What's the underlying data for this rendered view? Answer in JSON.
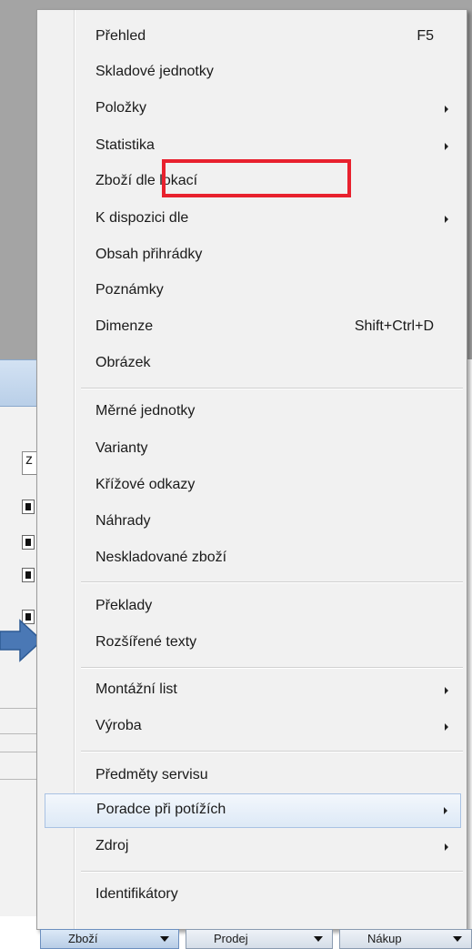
{
  "background": {
    "field_text": "z"
  },
  "menu": {
    "items": [
      {
        "label": "Přehled",
        "shortcut": "F5",
        "submenu": false
      },
      {
        "label": "Skladové jednotky",
        "shortcut": "",
        "submenu": false
      },
      {
        "label": "Položky",
        "shortcut": "",
        "submenu": true
      },
      {
        "label": "Statistika",
        "shortcut": "",
        "submenu": true
      },
      {
        "label": "Zboží dle lokací",
        "shortcut": "",
        "submenu": false,
        "annotated": true
      },
      {
        "label": "K dispozici dle",
        "shortcut": "",
        "submenu": true
      },
      {
        "label": "Obsah přihrádky",
        "shortcut": "",
        "submenu": false
      },
      {
        "label": "Poznámky",
        "shortcut": "",
        "submenu": false
      },
      {
        "label": "Dimenze",
        "shortcut": "Shift+Ctrl+D",
        "submenu": false
      },
      {
        "label": "Obrázek",
        "shortcut": "",
        "submenu": false
      },
      {
        "label": "Měrné jednotky",
        "shortcut": "",
        "submenu": false
      },
      {
        "label": "Varianty",
        "shortcut": "",
        "submenu": false
      },
      {
        "label": "Křížové odkazy",
        "shortcut": "",
        "submenu": false
      },
      {
        "label": "Náhrady",
        "shortcut": "",
        "submenu": false
      },
      {
        "label": "Neskladované zboží",
        "shortcut": "",
        "submenu": false
      },
      {
        "label": "Překlady",
        "shortcut": "",
        "submenu": false
      },
      {
        "label": "Rozšířené texty",
        "shortcut": "",
        "submenu": false
      },
      {
        "label": "Montážní list",
        "shortcut": "",
        "submenu": true
      },
      {
        "label": "Výroba",
        "shortcut": "",
        "submenu": true
      },
      {
        "label": "Předměty servisu",
        "shortcut": "",
        "submenu": false
      },
      {
        "label": "Poradce při potížích",
        "shortcut": "",
        "submenu": true,
        "highlighted": true
      },
      {
        "label": "Zdroj",
        "shortcut": "",
        "submenu": true
      },
      {
        "label": "Identifikátory",
        "shortcut": "",
        "submenu": false
      }
    ]
  },
  "toolbar": {
    "buttons": [
      {
        "label": "Zboží",
        "active": true
      },
      {
        "label": "Prodej",
        "active": false
      },
      {
        "label": "Nákup",
        "active": false
      }
    ]
  },
  "colors": {
    "annotation_box": "#e8212e",
    "arrow": "#4a78b5",
    "highlight": "#dde9f6"
  }
}
